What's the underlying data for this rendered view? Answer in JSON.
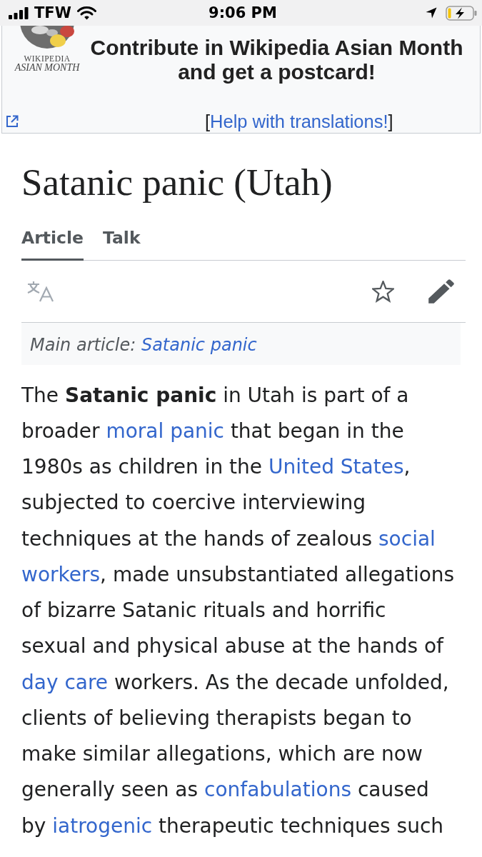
{
  "status_bar": {
    "carrier": "TFW",
    "time": "9:06 PM"
  },
  "banner": {
    "logo": {
      "line_1": "WIKIPEDIA",
      "line_2": "ASIAN MONTH"
    },
    "lines": [
      "Contribute in Wikipedia Asian Month",
      "and get a postcard!"
    ],
    "help": {
      "before": "[",
      "link": "Help with translations!",
      "after": "]"
    }
  },
  "page": {
    "title": "Satanic panic (Utah)",
    "tabs": [
      {
        "label": "Article",
        "selected": true
      },
      {
        "label": "Talk",
        "selected": false
      }
    ],
    "toolbar": {
      "language_button": {
        "disabled": true
      },
      "watch_button": {
        "disabled": false
      },
      "edit_button": {
        "disabled": false
      }
    },
    "hatnote": {
      "label": "Main article: ",
      "link": "Satanic panic"
    },
    "paragraph": [
      {
        "kind": "text",
        "text": "The "
      },
      {
        "kind": "bold",
        "text": "Satanic panic"
      },
      {
        "kind": "text",
        "text": " in Utah is part of a\nbroader "
      },
      {
        "kind": "link",
        "text": "moral panic"
      },
      {
        "kind": "text",
        "text": " that began in the\n1980s as children in the "
      },
      {
        "kind": "link",
        "text": "United States"
      },
      {
        "kind": "text",
        "text": ",\nsubjected to coercive interviewing\ntechniques at the hands of zealous "
      },
      {
        "kind": "link",
        "text": "social"
      },
      {
        "kind": "break"
      },
      {
        "kind": "link",
        "text": "workers"
      },
      {
        "kind": "text",
        "text": ", made unsubstantiated allegations\nof bizarre Satanic rituals and horrific\nsexual and physical abuse at the hands of\n"
      },
      {
        "kind": "link",
        "text": "day care"
      },
      {
        "kind": "text",
        "text": " workers. As the decade unfolded,\nclients of believing therapists began to\nmake similar allegations, which are now\ngenerally seen as "
      },
      {
        "kind": "link",
        "text": "confabulations"
      },
      {
        "kind": "text",
        "text": " caused\nby "
      },
      {
        "kind": "link",
        "text": "iatrogenic"
      },
      {
        "kind": "text",
        "text": " therapeutic techniques such"
      }
    ]
  }
}
